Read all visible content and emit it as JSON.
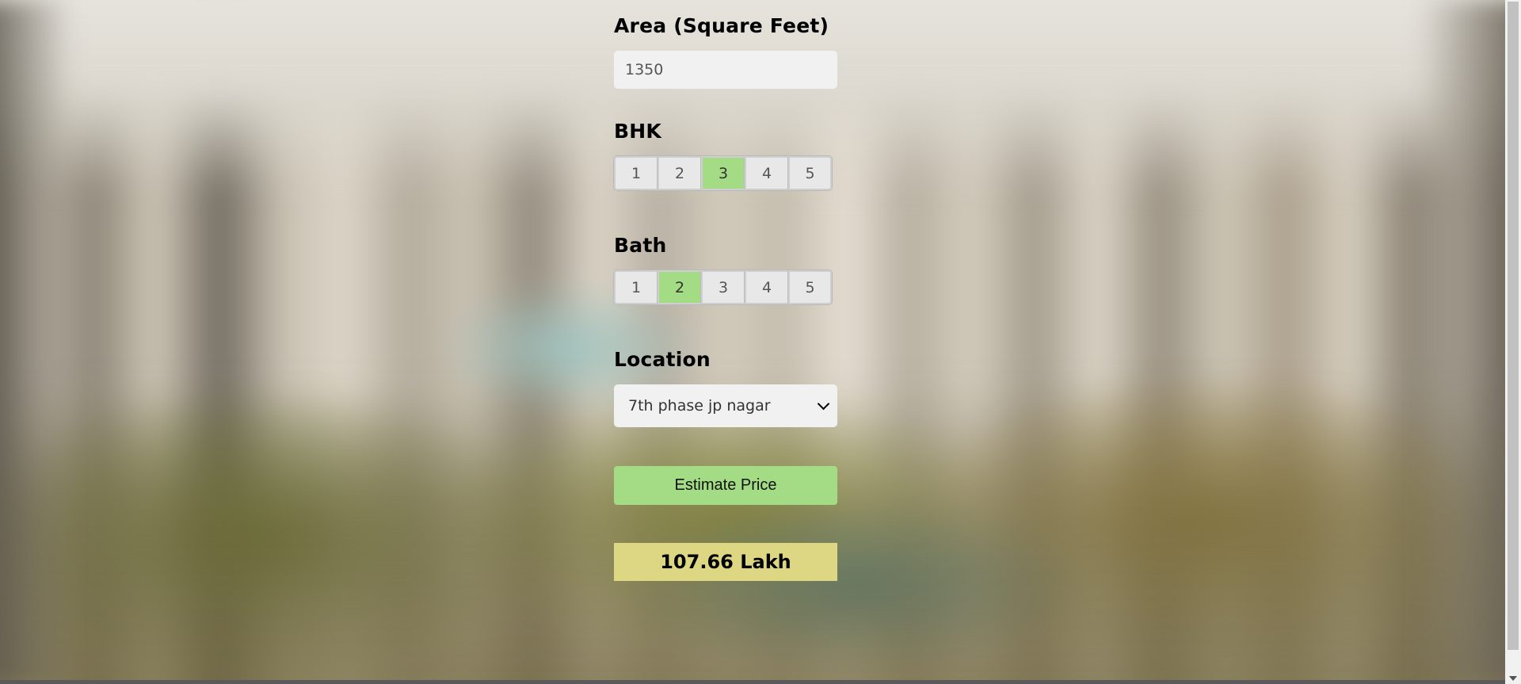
{
  "form": {
    "area_label": "Area (Square Feet)",
    "area_value": "1350",
    "bhk_label": "BHK",
    "bhk_options": [
      "1",
      "2",
      "3",
      "4",
      "5"
    ],
    "bhk_selected": "3",
    "bath_label": "Bath",
    "bath_options": [
      "1",
      "2",
      "3",
      "4",
      "5"
    ],
    "bath_selected": "2",
    "location_label": "Location",
    "location_selected": "7th phase jp nagar",
    "estimate_button_label": "Estimate Price",
    "result_text": "107.66 Lakh"
  },
  "colors": {
    "selected_option": "#a3dc85",
    "estimate_button": "#a3dc85",
    "result_background": "#ddd784"
  }
}
